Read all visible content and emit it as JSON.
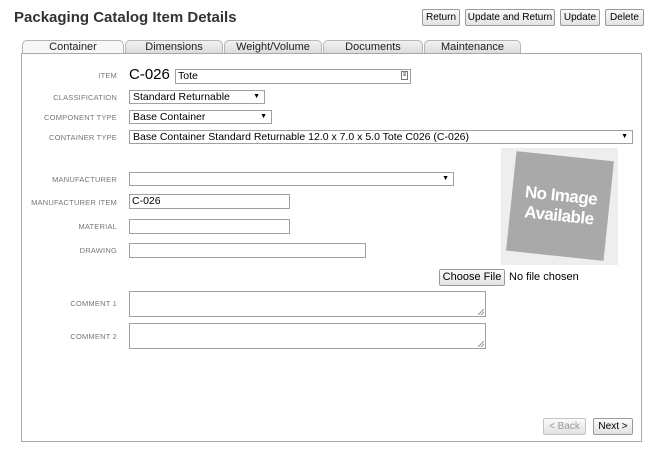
{
  "page": {
    "title": "Packaging Catalog Item Details"
  },
  "toolbar": {
    "return_label": "Return",
    "update_and_return_label": "Update and Return",
    "update_label": "Update",
    "delete_label": "Delete"
  },
  "tabs": [
    {
      "label": "Container",
      "active": true
    },
    {
      "label": "Dimensions",
      "active": false
    },
    {
      "label": "Weight/Volume",
      "active": false
    },
    {
      "label": "Documents",
      "active": false
    },
    {
      "label": "Maintenance",
      "active": false
    }
  ],
  "form": {
    "item": {
      "label": "ITEM",
      "code": "C-026",
      "value": "Tote"
    },
    "classification": {
      "label": "CLASSIFICATION",
      "value": "Standard Returnable"
    },
    "component_type": {
      "label": "COMPONENT TYPE",
      "value": "Base Container"
    },
    "container_type": {
      "label": "CONTAINER TYPE",
      "value": "Base Container Standard Returnable 12.0 x 7.0 x 5.0 Tote C026 (C-026)"
    },
    "manufacturer": {
      "label": "MANUFACTURER",
      "value": ""
    },
    "manufacturer_item": {
      "label": "MANUFACTURER ITEM",
      "value": "C-026"
    },
    "material": {
      "label": "MATERIAL",
      "value": ""
    },
    "drawing": {
      "label": "DRAWING",
      "value": ""
    },
    "comment1": {
      "label": "COMMENT 1",
      "value": ""
    },
    "comment2": {
      "label": "COMMENT 2",
      "value": ""
    }
  },
  "image": {
    "placeholder_line1": "No Image",
    "placeholder_line2": "Available"
  },
  "file_upload": {
    "button_label": "Choose File",
    "status": "No file chosen"
  },
  "nav": {
    "back_label": "< Back",
    "next_label": "Next >"
  }
}
